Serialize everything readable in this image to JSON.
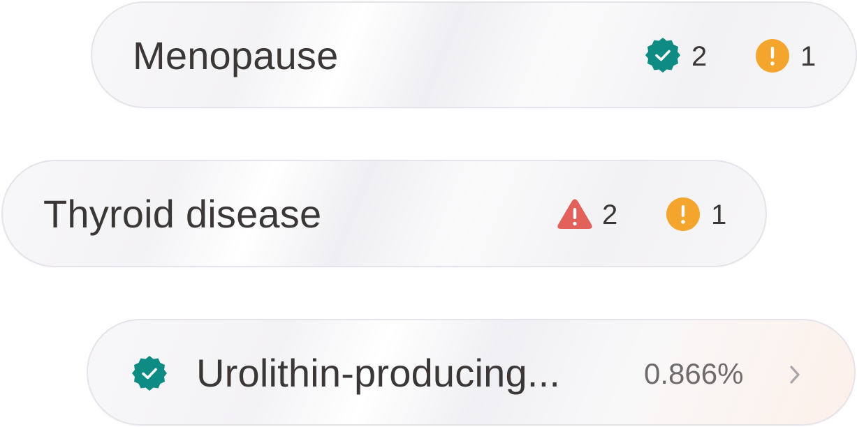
{
  "items": [
    {
      "label": "Menopause",
      "badges": [
        {
          "icon": "verified-check-icon",
          "count": "2",
          "color": "#0e8c84"
        },
        {
          "icon": "warning-circle-icon",
          "count": "1",
          "color": "#f4a52e"
        }
      ]
    },
    {
      "label": "Thyroid disease",
      "badges": [
        {
          "icon": "alert-triangle-icon",
          "count": "2",
          "color": "#e2615a"
        },
        {
          "icon": "warning-circle-icon",
          "count": "1",
          "color": "#f4a52e"
        }
      ]
    },
    {
      "label": "Urolithin-producing...",
      "status_icon": "verified-check-icon",
      "status_color": "#0e8c84",
      "value": "0.866%",
      "action_icon": "chevron-right-icon"
    }
  ]
}
